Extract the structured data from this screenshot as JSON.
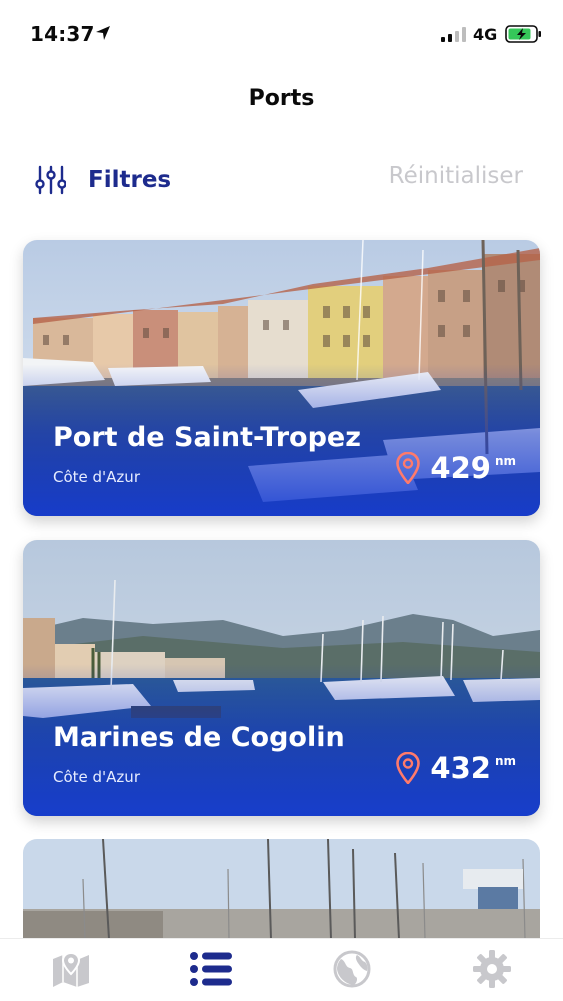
{
  "status_bar": {
    "time": "14:37",
    "network": "4G",
    "icons": [
      "location-arrow-icon",
      "signal-icon",
      "battery-charging-icon"
    ]
  },
  "header": {
    "title": "Ports"
  },
  "filters": {
    "filter_label": "Filtres",
    "reset_label": "Réinitialiser",
    "icon": "sliders-icon"
  },
  "ports": [
    {
      "name": "Port de Saint-Tropez",
      "region": "Côte d'Azur",
      "distance": "429",
      "unit": "nm"
    },
    {
      "name": "Marines de Cogolin",
      "region": "Côte d'Azur",
      "distance": "432",
      "unit": "nm"
    }
  ],
  "tab_bar": {
    "tabs": [
      {
        "icon": "map-icon",
        "active": false
      },
      {
        "icon": "list-icon",
        "active": true
      },
      {
        "icon": "globe-icon",
        "active": false
      },
      {
        "icon": "gear-icon",
        "active": false
      }
    ]
  },
  "colors": {
    "accent": "#1d2b8d",
    "inactive": "#c8c8cc",
    "card_gradient": "#1637d2"
  }
}
